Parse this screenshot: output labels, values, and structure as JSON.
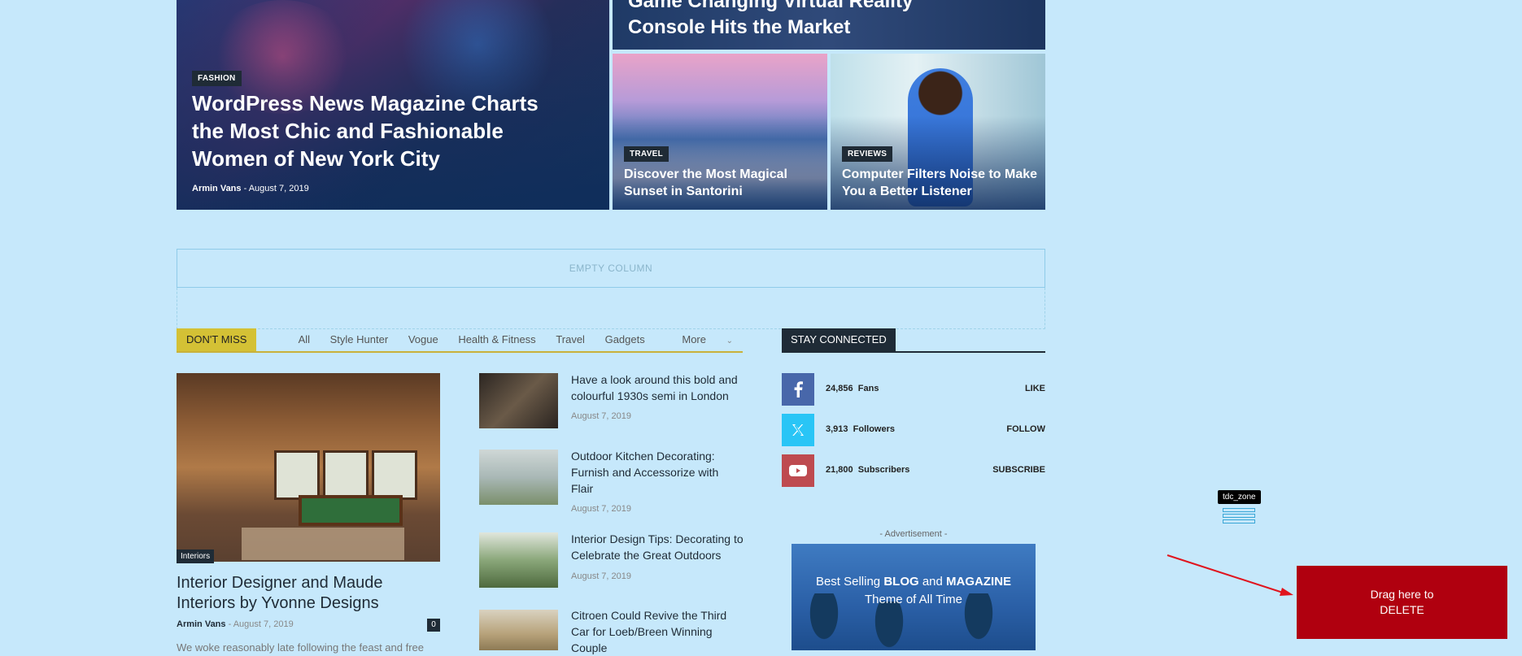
{
  "hero": {
    "top": {
      "title_line1": "Game Changing Virtual Reality",
      "title_line2": "Console Hits the Market"
    },
    "big": {
      "category": "FASHION",
      "title_line1": "WordPress News Magazine Charts",
      "title_line2": "the Most Chic and Fashionable",
      "title_line3": "Women of New York City",
      "author": "Armin Vans",
      "sep": "-",
      "date": "August 7, 2019"
    },
    "santorini": {
      "category": "TRAVEL",
      "title_line1": "Discover the Most Magical",
      "title_line2": "Sunset in Santorini"
    },
    "reviews": {
      "category": "REVIEWS",
      "title_line1": "Computer Filters Noise to Make",
      "title_line2": "You a Better Listener"
    }
  },
  "empty_column": {
    "label": "EMPTY COLUMN"
  },
  "dont_miss": {
    "label": "DON'T MISS",
    "tabs": [
      "All",
      "Style Hunter",
      "Vogue",
      "Health & Fitness",
      "Travel",
      "Gadgets",
      "More"
    ],
    "featured": {
      "tag": "Interiors",
      "title": "Interior Designer and Maude Interiors by Yvonne Designs",
      "author": "Armin Vans",
      "sep": "-",
      "date": "August 7, 2019",
      "comments": "0",
      "excerpt": "We woke reasonably late following the feast and free"
    },
    "list": [
      {
        "title": "Have a look around this bold and colourful 1930s semi in London",
        "date": "August 7, 2019"
      },
      {
        "title": "Outdoor Kitchen Decorating: Furnish and Accessorize with Flair",
        "date": "August 7, 2019"
      },
      {
        "title": "Interior Design Tips: Decorating to Celebrate the Great Outdoors",
        "date": "August 7, 2019"
      },
      {
        "title": "Citroen Could Revive the Third Car for Loeb/Breen Winning Couple",
        "date": ""
      }
    ]
  },
  "stay_connected": {
    "label": "STAY CONNECTED",
    "rows": [
      {
        "count": "24,856",
        "unit": "Fans",
        "action": "LIKE",
        "icon": "facebook-icon",
        "color": "#4867aa"
      },
      {
        "count": "3,913",
        "unit": "Followers",
        "action": "FOLLOW",
        "icon": "x-twitter-icon",
        "color": "#29c5f6"
      },
      {
        "count": "21,800",
        "unit": "Subscribers",
        "action": "SUBSCRIBE",
        "icon": "youtube-icon",
        "color": "#be4b50"
      }
    ]
  },
  "advertisement": {
    "label": "- Advertisement -",
    "line1_pre": "Best Selling ",
    "line1_b1": "BLOG",
    "line1_mid": " and ",
    "line1_b2": "MAGAZINE",
    "line2": "Theme of All Time"
  },
  "builder": {
    "zone_tooltip": "tdc_zone",
    "delete_line1": "Drag here to",
    "delete_line2": "DELETE"
  },
  "colors": {
    "background": "#c6e8fb",
    "accent_yellow": "#d4c135",
    "dark": "#1f2b36",
    "delete_red": "#b0000f"
  }
}
